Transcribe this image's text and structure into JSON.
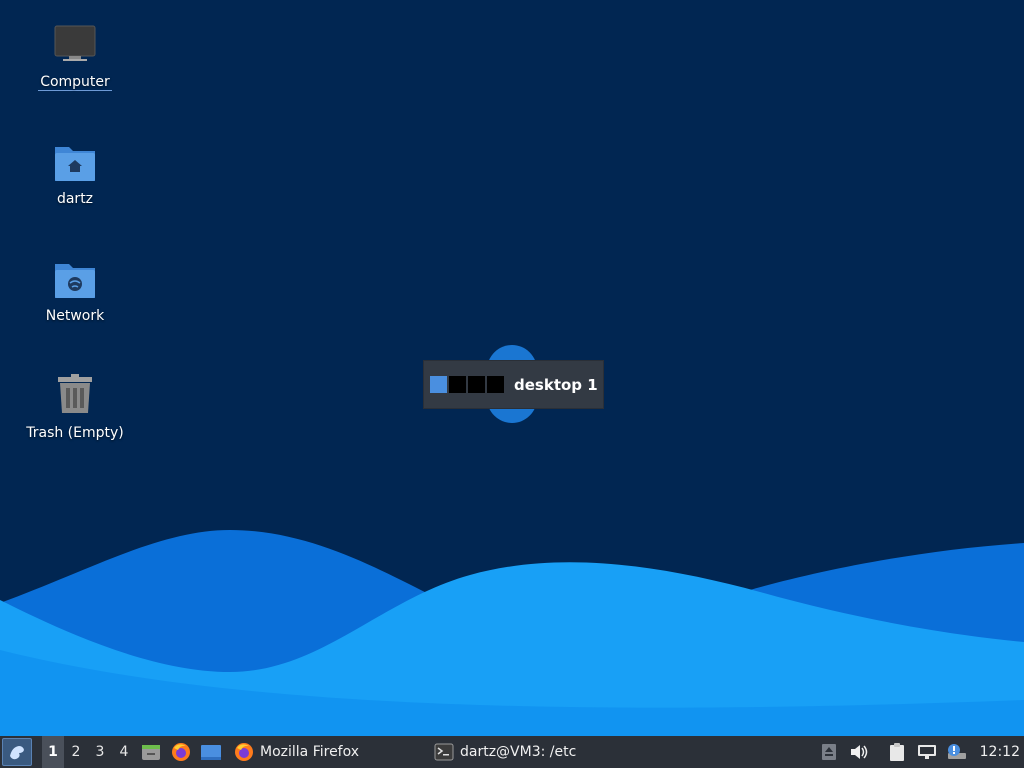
{
  "desktop": {
    "icons": [
      {
        "label": "Computer",
        "icon": "monitor-icon"
      },
      {
        "label": "dartz",
        "icon": "home-folder-icon"
      },
      {
        "label": "Network",
        "icon": "network-folder-icon"
      },
      {
        "label": "Trash (Empty)",
        "icon": "trash-icon"
      }
    ]
  },
  "workspace_popup": {
    "label": "desktop 1",
    "workspaces": 4,
    "active_index": 0
  },
  "panel": {
    "workspaces": [
      "1",
      "2",
      "3",
      "4"
    ],
    "launchers": [
      "file-manager-icon",
      "firefox-icon",
      "desktop-icon"
    ],
    "tasks": [
      {
        "label": "Mozilla Firefox",
        "icon": "firefox-icon"
      },
      {
        "label": "dartz@VM3: /etc",
        "icon": "terminal-icon"
      }
    ],
    "tray": [
      "eject-icon",
      "volume-icon",
      "clipboard-icon",
      "network-wired-icon",
      "updates-icon"
    ],
    "clock": "12:12"
  },
  "colors": {
    "desktop_bg": "#012652",
    "wave_light": "#18a0f6",
    "wave_mid": "#0e8ff0",
    "wave_dark": "#0a6fd8",
    "panel_bg": "#2b3038",
    "active_workspace": "#4a8fe0"
  }
}
